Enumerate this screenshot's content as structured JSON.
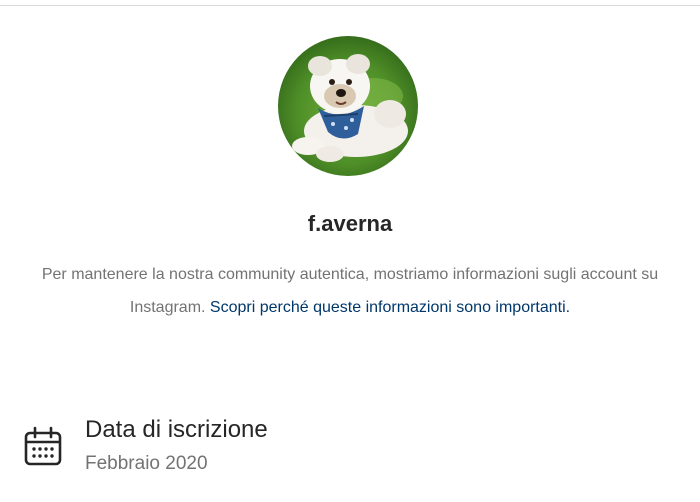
{
  "profile": {
    "username": "f.averna",
    "avatar_alt": "profile picture"
  },
  "about": {
    "text_before_link": "Per mantenere la nostra community autentica, mostriamo informazioni sugli account su Instagram. ",
    "link_text": "Scopri perché queste informazioni sono importanti.",
    "link_color": "#00376b"
  },
  "join_date": {
    "icon": "calendar-icon",
    "title": "Data di iscrizione",
    "value": "Febbraio 2020"
  }
}
